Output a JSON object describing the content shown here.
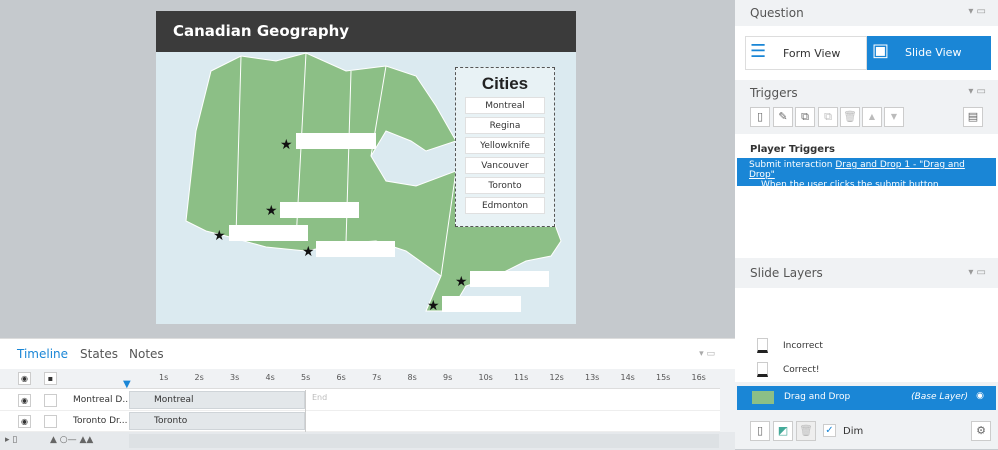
{
  "slide": {
    "title": "Canadian Geography",
    "cities_title": "Cities",
    "cities": [
      "Montreal",
      "Regina",
      "Yellowknife",
      "Vancouver",
      "Toronto",
      "Edmonton"
    ]
  },
  "timeline": {
    "tabs": [
      "Timeline",
      "States",
      "Notes"
    ],
    "ticks": [
      "1s",
      "2s",
      "3s",
      "4s",
      "5s",
      "6s",
      "7s",
      "8s",
      "9s",
      "10s",
      "11s",
      "12s",
      "13s",
      "14s",
      "15s",
      "16s"
    ],
    "end_label": "End",
    "rows": [
      {
        "name": "Montreal D...",
        "bar": "Montreal"
      },
      {
        "name": "Toronto Dr...",
        "bar": "Toronto"
      }
    ]
  },
  "question": {
    "title": "Question",
    "form_view": "Form View",
    "slide_view": "Slide View"
  },
  "triggers": {
    "title": "Triggers",
    "section": "Player Triggers",
    "action": "Submit interaction",
    "link": "Drag and Drop 1 - \"Drag and Drop\"",
    "condition": "When the user clicks the submit button"
  },
  "layers": {
    "title": "Slide Layers",
    "items": [
      "Incorrect",
      "Correct!"
    ],
    "base": "Drag and Drop",
    "base_tag": "(Base Layer)",
    "dim": "Dim"
  },
  "colors": {
    "accent": "#1a86d6",
    "map": "#8cbf86",
    "title_bar": "#3b3b3b"
  }
}
